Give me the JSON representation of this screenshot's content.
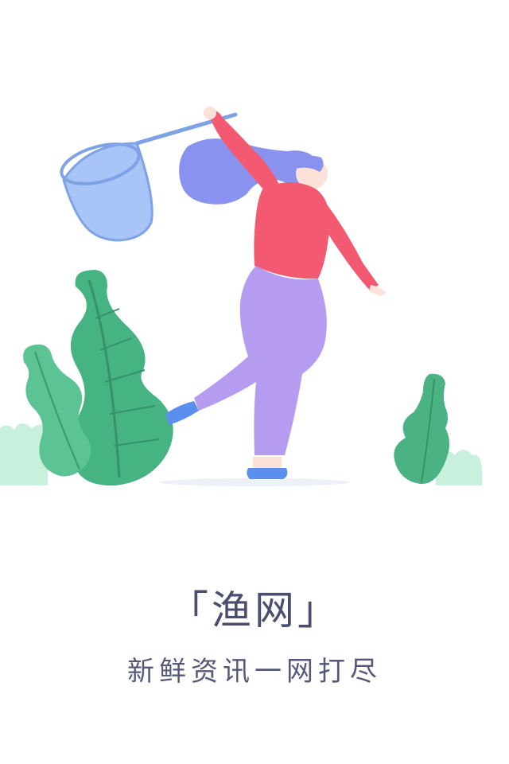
{
  "splash": {
    "title": "「渔网」",
    "tagline": "新鲜资讯一网打尽"
  },
  "illustration": {
    "icon": "girl-catching-with-net-illustration",
    "colors": {
      "net": "#8fb1ee",
      "hair": "#8b93ee",
      "shirt": "#f35a72",
      "pants": "#b59cf0",
      "shoes": "#5a8ff0",
      "leaves": "#4db886",
      "bush": "#c8f0dc"
    }
  }
}
